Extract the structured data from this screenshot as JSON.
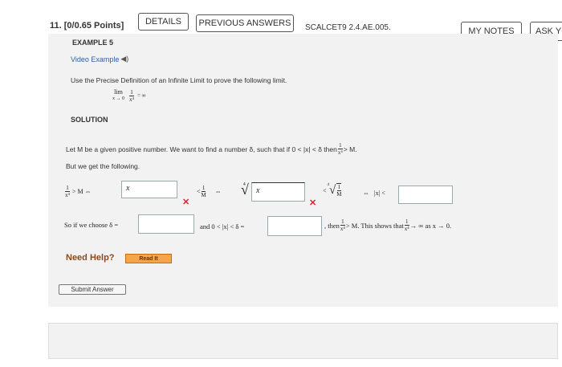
{
  "header": {
    "question_number": "11.",
    "points": "[0/0.65 Points]",
    "details_label": "DETAILS",
    "previous_answers_label": "PREVIOUS ANSWERS",
    "problem_code": "SCALCET9 2.4.AE.005.",
    "my_notes_label": "MY NOTES",
    "ask_label": "ASK YO"
  },
  "example": {
    "title": "EXAMPLE 5",
    "video_label": "Video Example",
    "instruction": "Use the Precise Definition of an Infinite Limit to prove the following limit.",
    "limit_expr": {
      "lim": "lim",
      "sub": "x → 0",
      "num": "1",
      "den": "x⁴",
      "rhs": "= ∞"
    }
  },
  "solution": {
    "heading": "SOLUTION",
    "intro": "Let M be a given positive number. We want to find a number δ, such that if 0 < |x| < δ then",
    "intro_tail": "> M.",
    "intro_frac": {
      "num": "1",
      "den": "x⁴"
    },
    "following": "But we get the following.",
    "step_left": {
      "num": "1",
      "den": "x⁴",
      "rel": "> M  ⇔"
    },
    "box1_value": "x",
    "step_mid": {
      "lt": "<",
      "num": "1",
      "den": "M",
      "iff": "⇔"
    },
    "root_index": "4",
    "box2_value": "x",
    "step_root": {
      "lt": "<",
      "index": "4",
      "num": "1",
      "den": "M"
    },
    "abs_expr": "⇔   |x| <",
    "choose_prefix": "So if we choose δ =",
    "and_text": "and 0 < |x| < δ =",
    "then_text": ", then",
    "then_frac": {
      "num": "1",
      "den": "x⁴"
    },
    "shows_text": "> M. This shows that",
    "shows_frac": {
      "num": "1",
      "den": "x⁴"
    },
    "conclusion": "→ ∞ as x → 0."
  },
  "help": {
    "need_help": "Need Help?",
    "read_it": "Read It"
  },
  "submit_label": "Submit Answer",
  "colors": {
    "incorrect": "#dd2233",
    "read_it_bg": "#f5a54a",
    "link": "#2a5f9e"
  }
}
